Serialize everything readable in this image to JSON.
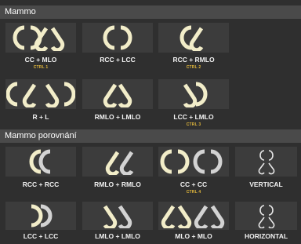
{
  "sections": [
    {
      "title": "Mammo",
      "tiles": [
        {
          "label": "CC + MLO",
          "shortcut": "CTRL 1",
          "icon": "cc-mlo-icon"
        },
        {
          "label": "RCC + LCC",
          "shortcut": "",
          "icon": "rcc-lcc-icon"
        },
        {
          "label": "RCC + RMLO",
          "shortcut": "CTRL 2",
          "icon": "rcc-rmlo-icon"
        },
        {
          "label": "R + L",
          "shortcut": "",
          "icon": "r-l-icon"
        },
        {
          "label": "RMLO + LMLO",
          "shortcut": "",
          "icon": "rmlo-lmlo-icon"
        },
        {
          "label": "LCC + LMLO",
          "shortcut": "CTRL 3",
          "icon": "lcc-lmlo-icon"
        }
      ]
    },
    {
      "title": "Mammo porovnání",
      "tiles": [
        {
          "label": "RCC + RCC",
          "shortcut": "",
          "icon": "rcc-rcc-icon"
        },
        {
          "label": "RMLO + RMLO",
          "shortcut": "",
          "icon": "rmlo-rmlo-icon"
        },
        {
          "label": "CC + CC",
          "shortcut": "CTRL 4",
          "icon": "cc-cc-icon"
        },
        {
          "label": "VERTICAL",
          "shortcut": "",
          "icon": "vertical-icon"
        },
        {
          "label": "LCC + LCC",
          "shortcut": "",
          "icon": "lcc-lcc-icon"
        },
        {
          "label": "LMLO + LMLO",
          "shortcut": "",
          "icon": "lmlo-lmlo-icon"
        },
        {
          "label": "MLO + MLO",
          "shortcut": "",
          "icon": "mlo-mlo-icon"
        },
        {
          "label": "HORIZONTAL",
          "shortcut": "",
          "icon": "horizontal-icon"
        }
      ]
    }
  ],
  "colors": {
    "background": "#2f2f2f",
    "header": "#4a4a4a",
    "tile": "#3c3c3c",
    "icon_primary": "#f2edc9",
    "icon_compare": "#d3d3d3",
    "shortcut": "#e2b83c"
  }
}
